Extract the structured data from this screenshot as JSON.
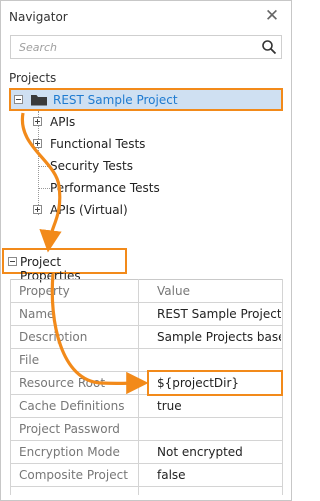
{
  "navigator": {
    "title": "Navigator",
    "search_placeholder": "Search",
    "projects_label": "Projects"
  },
  "tree": {
    "root_label": "REST Sample Project",
    "items": [
      {
        "label": "APIs",
        "expandable": true
      },
      {
        "label": "Functional Tests",
        "expandable": true
      },
      {
        "label": "Security Tests",
        "expandable": false
      },
      {
        "label": "Performance Tests",
        "expandable": false
      },
      {
        "label": "APIs (Virtual)",
        "expandable": true
      }
    ]
  },
  "properties": {
    "title": "Project Properties",
    "columns": [
      "Property",
      "Value"
    ],
    "rows": [
      {
        "name": "Name",
        "value": "REST Sample Project"
      },
      {
        "name": "Description",
        "value": "Sample Projects bases..."
      },
      {
        "name": "File",
        "value": ""
      },
      {
        "name": "Resource Root",
        "value": "${projectDir}"
      },
      {
        "name": "Cache Definitions",
        "value": "true"
      },
      {
        "name": "Project Password",
        "value": ""
      },
      {
        "name": "Encryption Mode",
        "value": "Not encrypted"
      },
      {
        "name": "Composite Project",
        "value": "false"
      }
    ]
  },
  "colors": {
    "accent": "#f28a1a",
    "selection": "#cfe0f2",
    "root_text": "#1f7bd0"
  },
  "icons": {
    "close": "close-icon",
    "search": "search-icon",
    "folder": "folder-icon"
  }
}
